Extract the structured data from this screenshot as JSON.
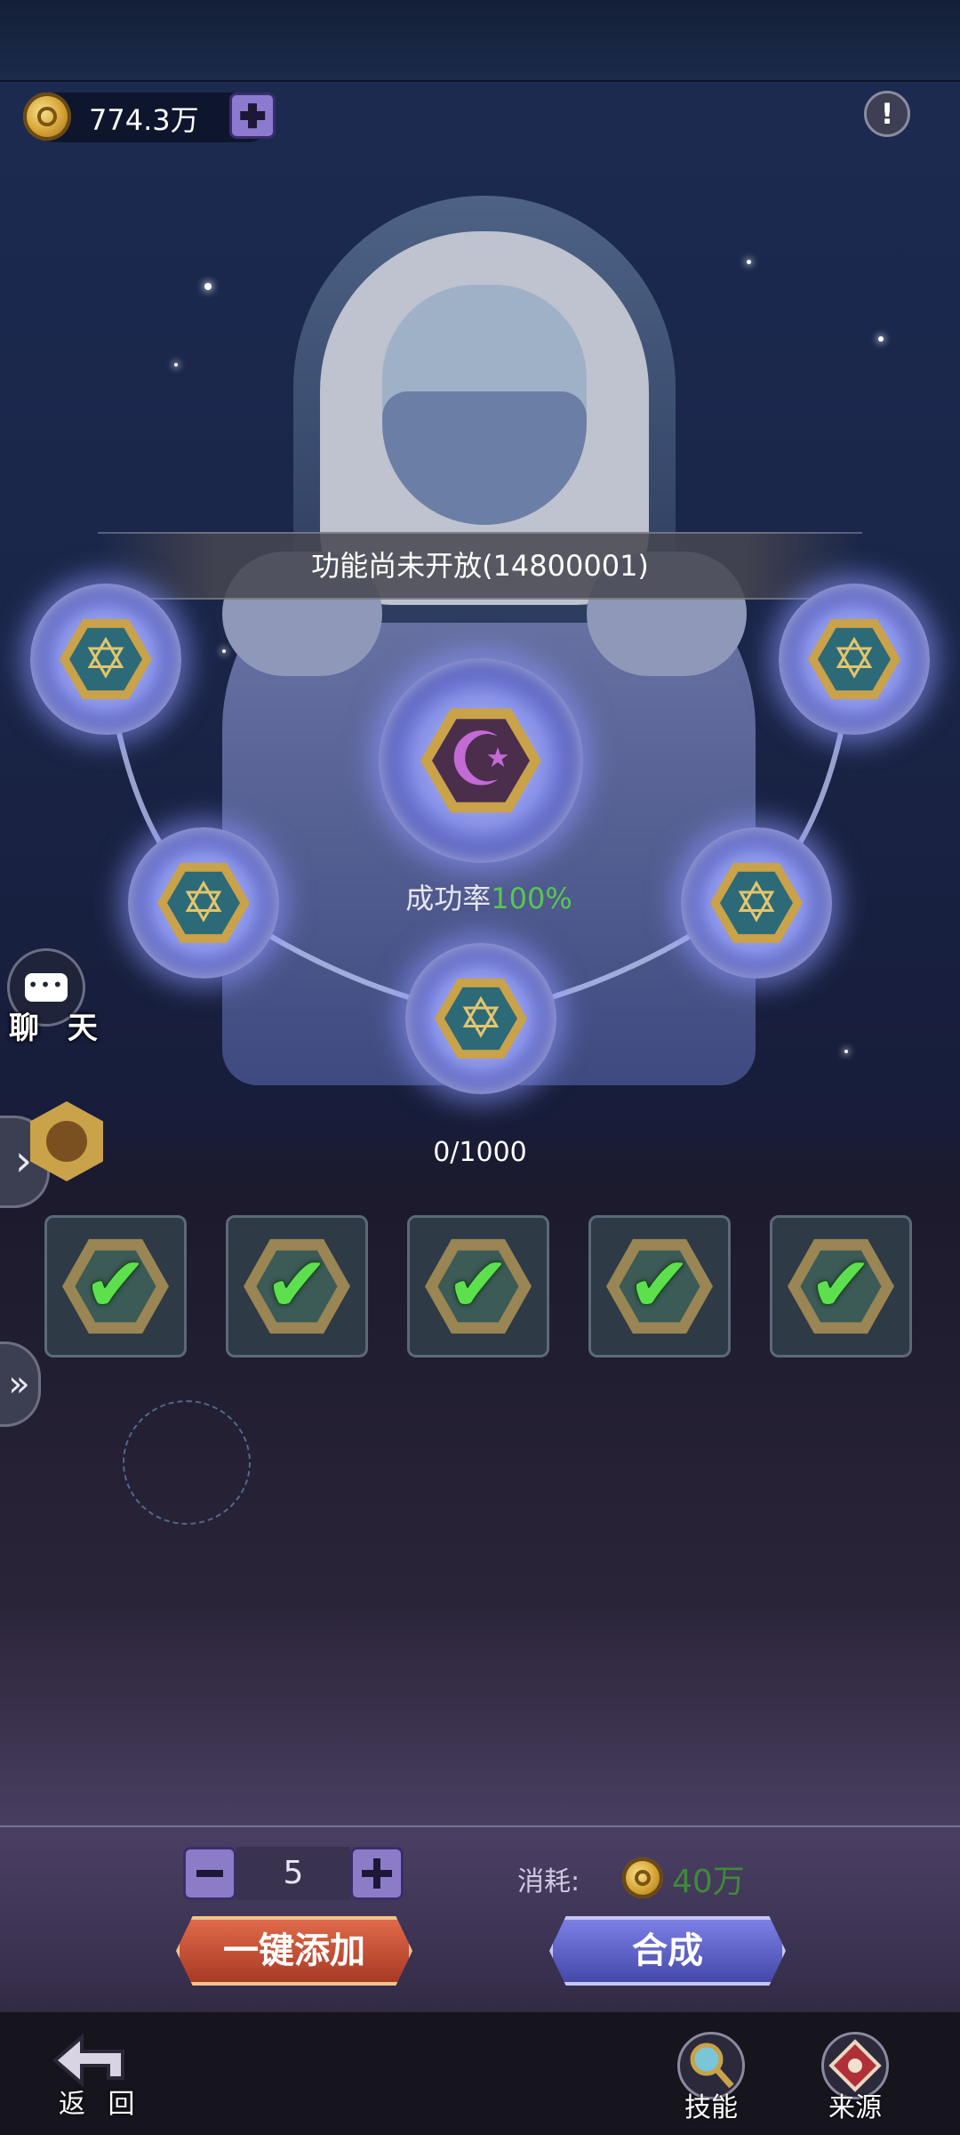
{
  "currency": {
    "amount": "774.3万"
  },
  "banner": {
    "text": "功能尚未开放(14800001)"
  },
  "synthesis": {
    "rate_label": "成功率",
    "rate_value": "100%",
    "progress": "0/1000"
  },
  "chat": {
    "label": "聊 天"
  },
  "quantity": {
    "value": "5"
  },
  "cost": {
    "label": "消耗:",
    "value": "40万"
  },
  "buttons": {
    "add_all": "一键添加",
    "combine": "合成"
  },
  "nav": {
    "back": "返 回",
    "skill": "技能",
    "source": "来源"
  },
  "colors": {
    "success_green": "#57c84d",
    "cost_green": "#3f8a3a",
    "accent_purple": "#8c7cc8"
  }
}
